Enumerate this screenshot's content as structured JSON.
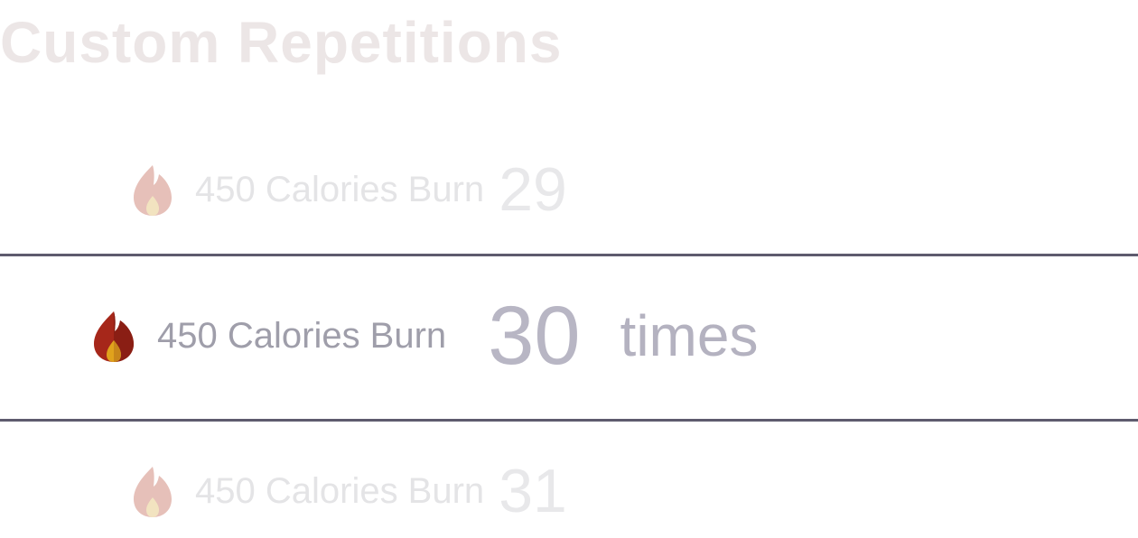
{
  "title": "Custom Repetitions",
  "picker": {
    "unit": "times",
    "items": [
      {
        "calories": "450 Calories Burn",
        "count": "29"
      },
      {
        "calories": "450 Calories Burn",
        "count": "30"
      },
      {
        "calories": "450 Calories Burn",
        "count": "31"
      }
    ],
    "selected_index": 1
  },
  "colors": {
    "divider": "#5e5b6e",
    "flame_active": "#a6271a",
    "flame_core": "#e0a21c",
    "flame_faded": "#e8c2bb"
  },
  "icons": {
    "flame": "flame-icon"
  }
}
